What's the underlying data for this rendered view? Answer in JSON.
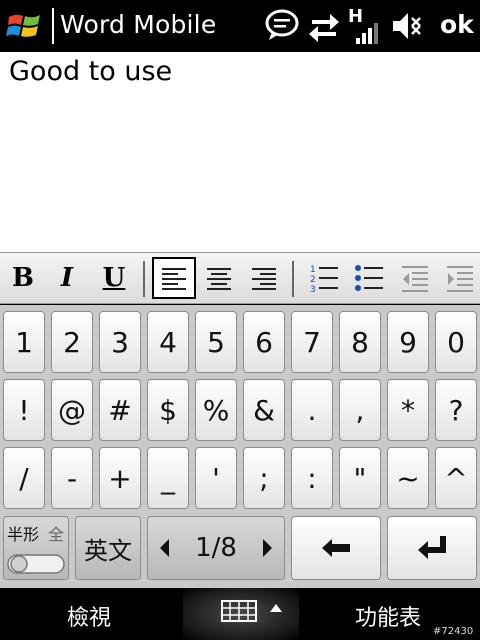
{
  "titlebar": {
    "app_title": "Word Mobile",
    "ok_label": "ok",
    "icons": [
      "windows-logo-icon",
      "message-icon",
      "sync-arrows-icon",
      "signal-hspa-icon",
      "speaker-mute-icon"
    ],
    "signal_label": "H"
  },
  "document": {
    "text": "Good to use"
  },
  "toolbar": {
    "bold": "B",
    "italic": "I",
    "underline": "U",
    "icons": [
      "align-left-icon",
      "align-center-icon",
      "align-right-icon",
      "numbered-list-icon",
      "bulleted-list-icon",
      "decrease-indent-icon",
      "increase-indent-icon"
    ]
  },
  "keyboard": {
    "row1": [
      "1",
      "2",
      "3",
      "4",
      "5",
      "6",
      "7",
      "8",
      "9",
      "0"
    ],
    "row2": [
      "!",
      "@",
      "#",
      "$",
      "%",
      "&",
      ".",
      ",",
      "*",
      "?"
    ],
    "row3": [
      "/",
      "-",
      "+",
      "_",
      "'",
      ";",
      ":",
      "\"",
      "~",
      "^"
    ],
    "halfwidth_label": "半形",
    "fullwidth_label": "全",
    "english_label": "英文",
    "page_indicator": "1/8",
    "icons": [
      "toggle-switch-icon",
      "arrow-left-icon",
      "arrow-right-icon",
      "backspace-icon",
      "enter-icon"
    ]
  },
  "softbar": {
    "left_label": "檢視",
    "right_label": "功能表",
    "icons": [
      "keyboard-icon",
      "caret-up-icon"
    ]
  },
  "watermark": "#72430",
  "colors": {
    "background": "#000000",
    "document": "#ffffff",
    "toolbar": "#e6e6e6",
    "keyboard": "#c9c9c9",
    "list_blue": "#1a4fb5"
  }
}
